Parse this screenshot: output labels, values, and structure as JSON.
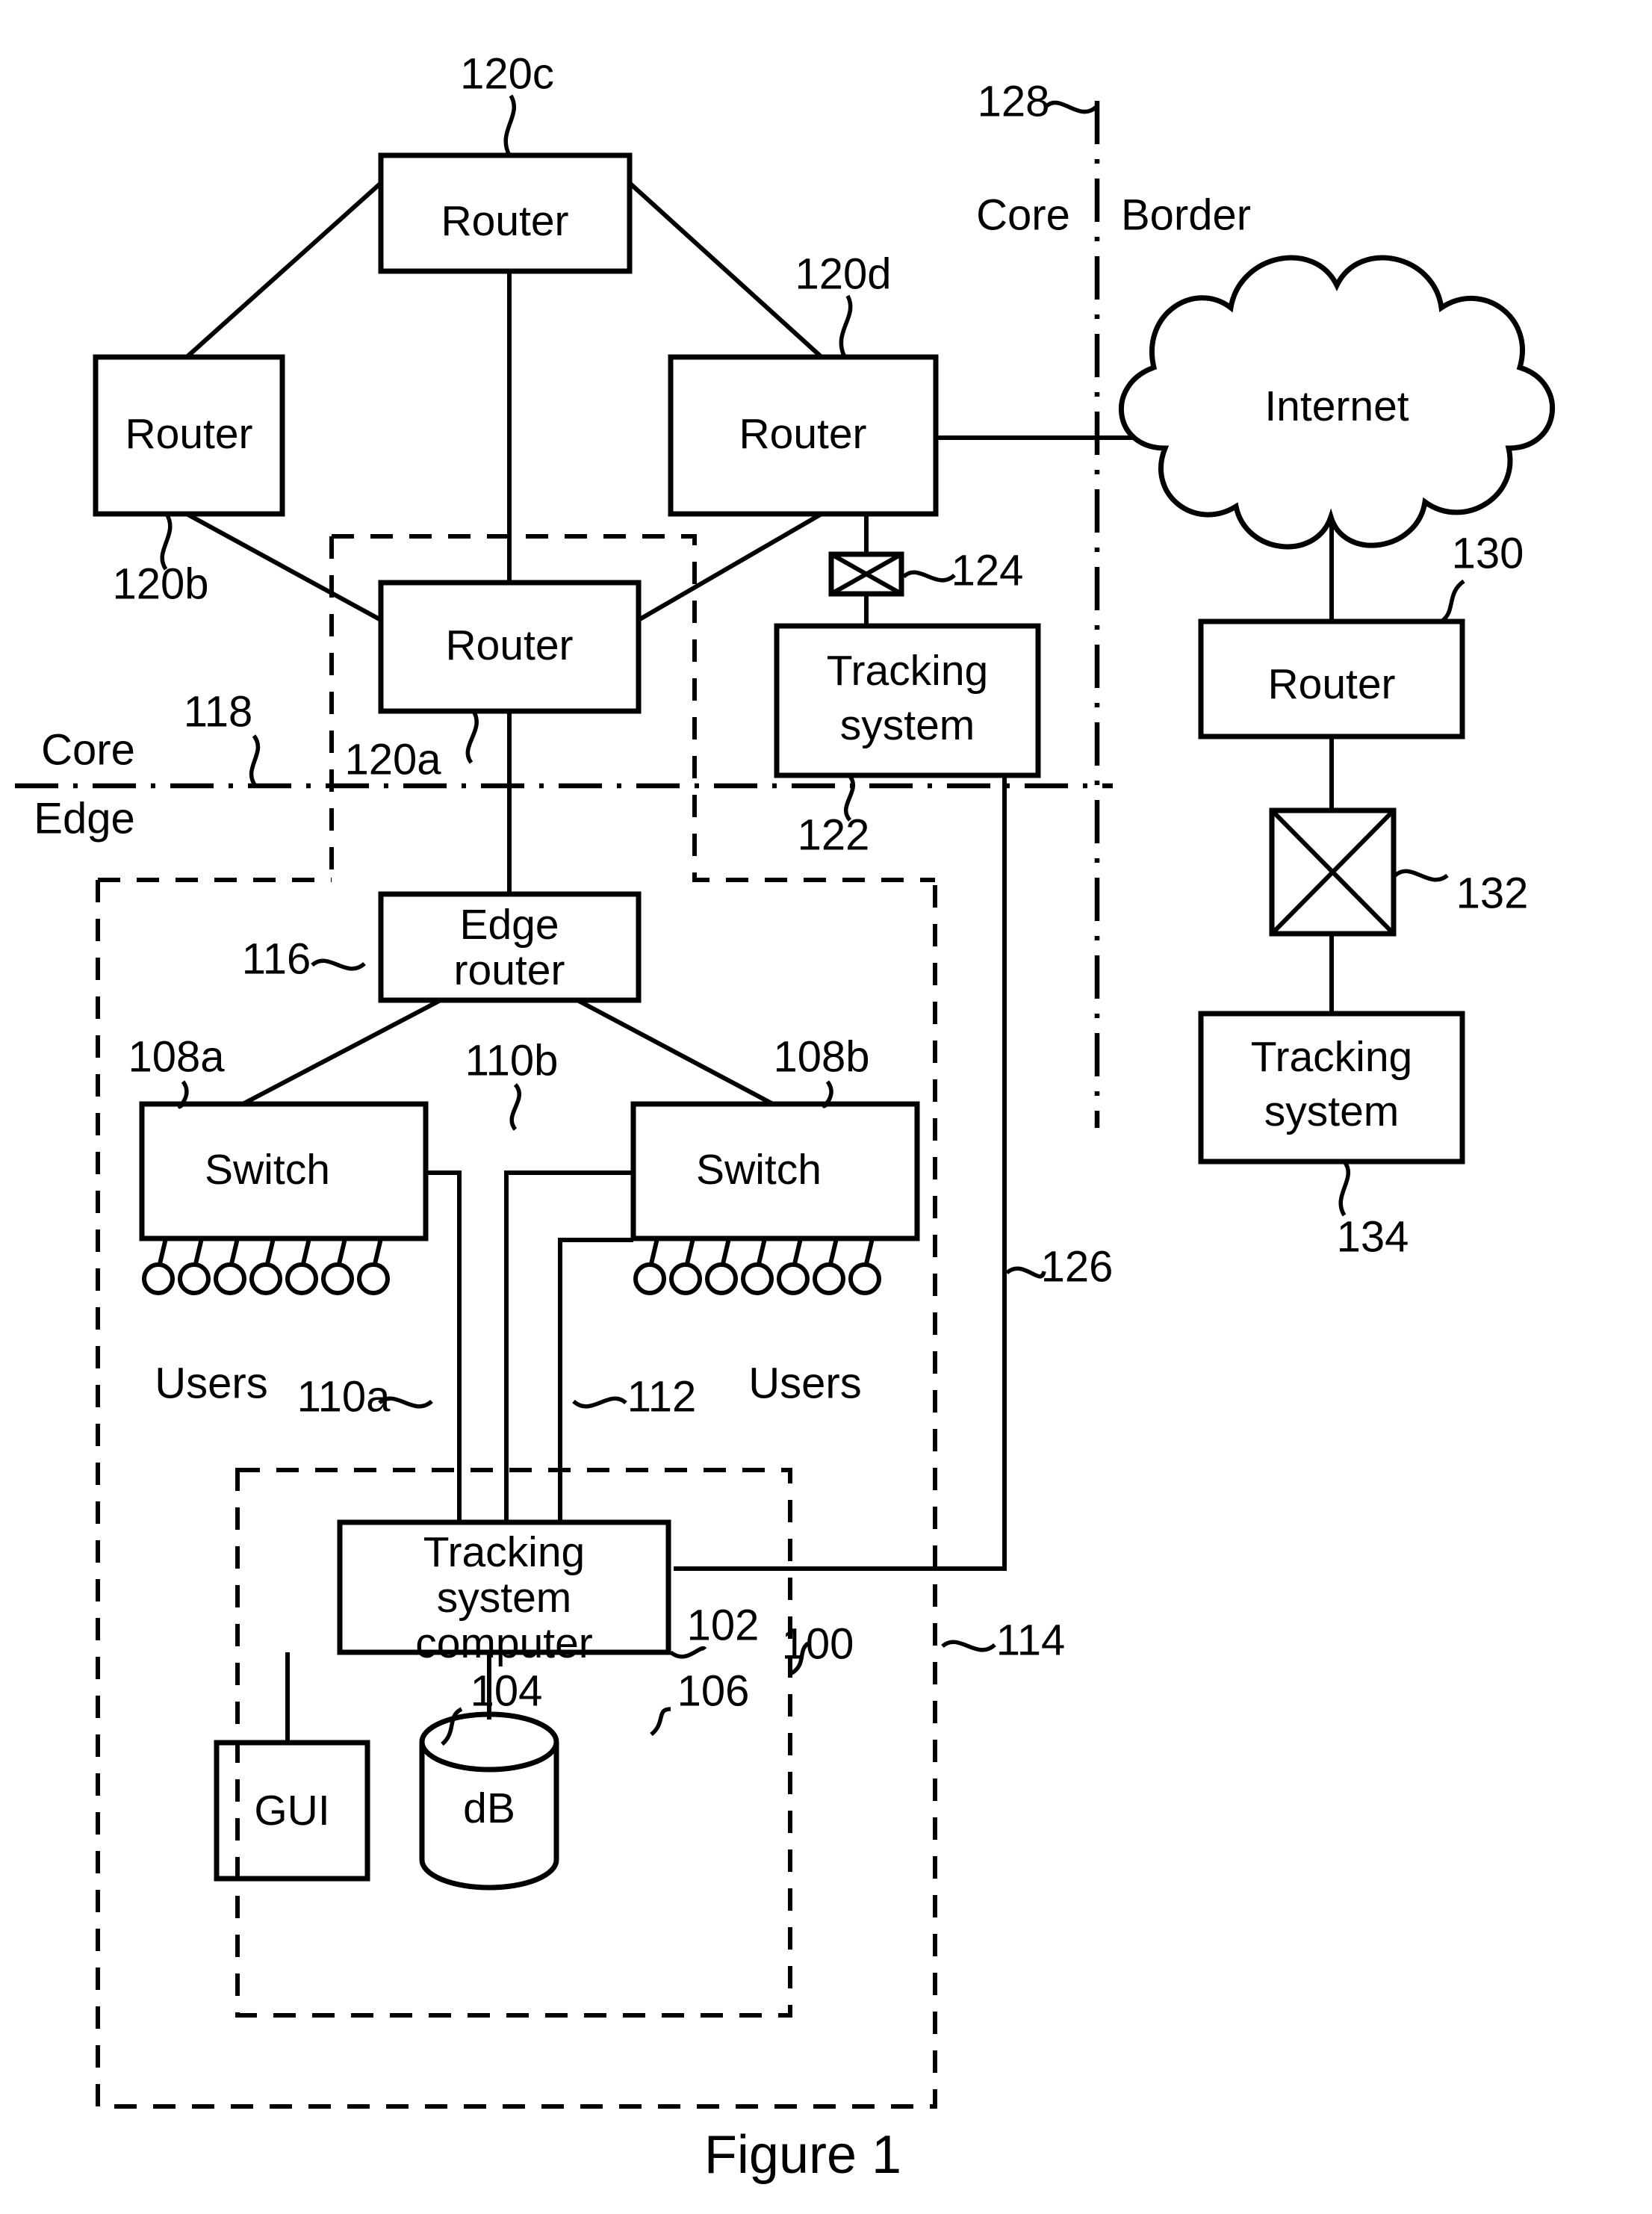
{
  "figure": {
    "caption": "Figure 1"
  },
  "zones": {
    "core_top_label": "Core",
    "edge_label": "Edge",
    "core_right_label": "Core",
    "border_label": "Border"
  },
  "nodes": {
    "router_120c": "Router",
    "router_120b": "Router",
    "router_120d": "Router",
    "router_120a": "Router",
    "internet_cloud": "Internet",
    "tracking_system_122": "Tracking\nsystem",
    "tracking_system_122_line1": "Tracking",
    "tracking_system_122_line2": "system",
    "router_130": "Router",
    "tracking_system_134_line1": "Tracking",
    "tracking_system_134_line2": "system",
    "edge_router_116_line1": "Edge",
    "edge_router_116_line2": "router",
    "switch_108a": "Switch",
    "switch_108b": "Switch",
    "users_left": "Users",
    "users_right": "Users",
    "tracking_computer_102_line1": "Tracking",
    "tracking_computer_102_line2": "system",
    "tracking_computer_102_line3": "computer",
    "gui_104": "GUI",
    "db_106": "dB"
  },
  "refs": {
    "r100": "100",
    "r102": "102",
    "r104": "104",
    "r106": "106",
    "r108a": "108a",
    "r108b": "108b",
    "r110a": "110a",
    "r110b": "110b",
    "r112": "112",
    "r114": "114",
    "r116": "116",
    "r118": "118",
    "r120a": "120a",
    "r120b": "120b",
    "r120c": "120c",
    "r120d": "120d",
    "r122": "122",
    "r124": "124",
    "r126": "126",
    "r128": "128",
    "r130": "130",
    "r132": "132",
    "r134": "134"
  },
  "colors": {
    "stroke": "#000000",
    "background": "#ffffff"
  }
}
